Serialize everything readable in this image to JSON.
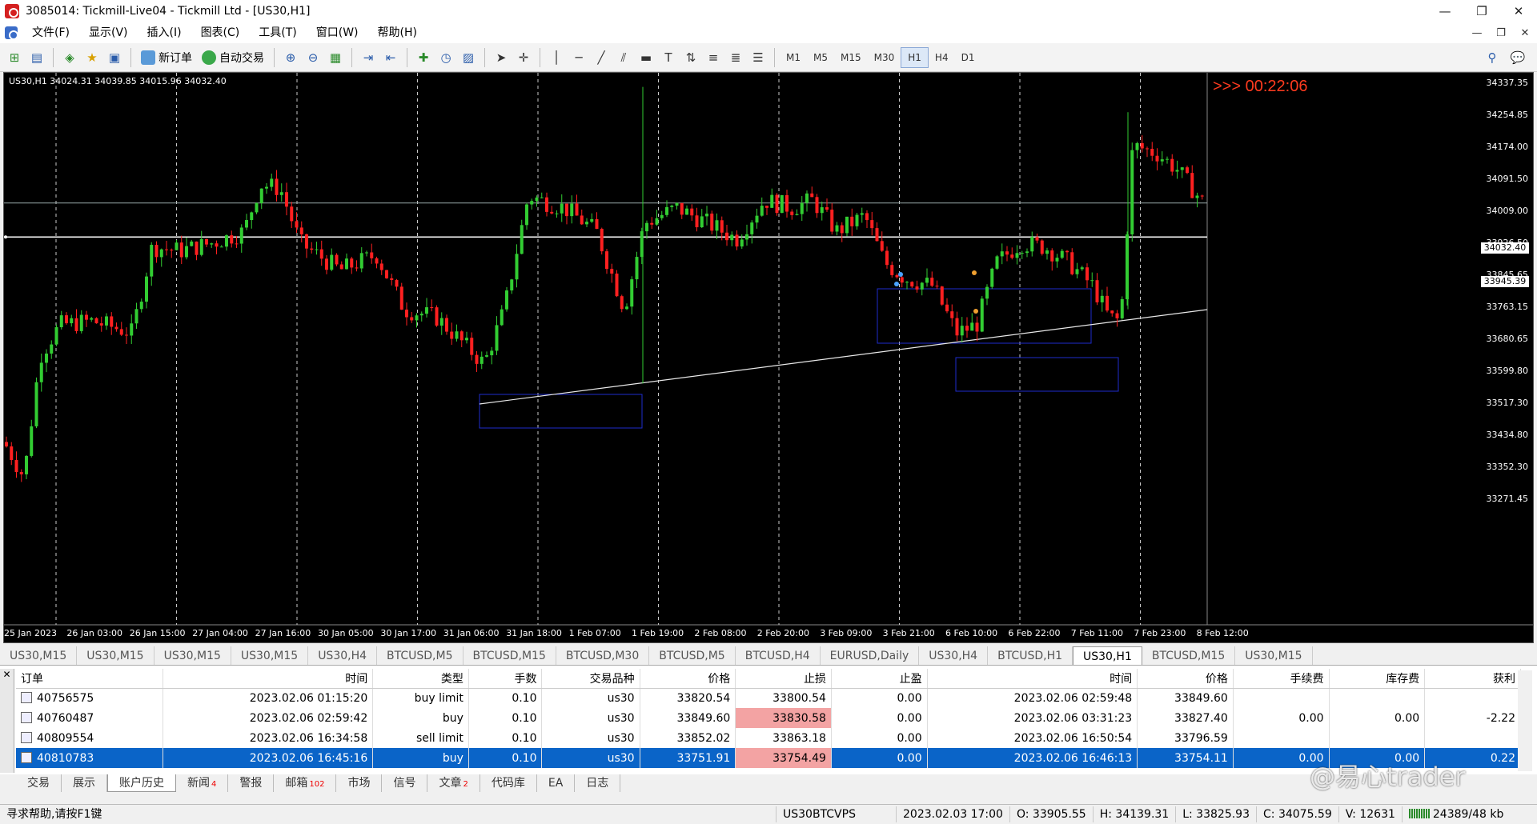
{
  "window": {
    "title": "3085014: Tickmill-Live04 - Tickmill Ltd - [US30,H1]"
  },
  "menu": [
    "文件(F)",
    "显示(V)",
    "插入(I)",
    "图表(C)",
    "工具(T)",
    "窗口(W)",
    "帮助(H)"
  ],
  "toolbar": {
    "new_order": "新订单",
    "auto_trading": "自动交易",
    "timeframes": [
      "M1",
      "M5",
      "M15",
      "M30",
      "H1",
      "H4",
      "D1"
    ],
    "active_timeframe": "H1"
  },
  "chart": {
    "info": "US30,H1  34024.31 34039.85 34015.96 34032.40",
    "countdown": ">>> 00:22:06",
    "price_axis": [
      "34337.35",
      "34254.85",
      "34174.00",
      "34091.50",
      "34009.00",
      "33926.50",
      "33845.65",
      "33763.15",
      "33680.65",
      "33599.80",
      "33517.30",
      "33434.80",
      "33352.30",
      "33271.45"
    ],
    "current_price_tag": "34032.40",
    "line_price_tag": "33945.39",
    "time_axis": [
      "25 Jan 2023",
      "26 Jan 03:00",
      "26 Jan 15:00",
      "27 Jan 04:00",
      "27 Jan 16:00",
      "30 Jan 05:00",
      "30 Jan 17:00",
      "31 Jan 06:00",
      "31 Jan 18:00",
      "1 Feb 07:00",
      "1 Feb 19:00",
      "2 Feb 08:00",
      "2 Feb 20:00",
      "3 Feb 09:00",
      "3 Feb 21:00",
      "6 Feb 10:00",
      "6 Feb 22:00",
      "7 Feb 11:00",
      "7 Feb 23:00",
      "8 Feb 12:00"
    ],
    "colors": {
      "bull": "#32cd32",
      "bear": "#ff2020",
      "background": "#000000"
    }
  },
  "chart_tabs": [
    "US30,M15",
    "US30,M15",
    "US30,M15",
    "US30,M15",
    "US30,H4",
    "BTCUSD,M5",
    "BTCUSD,M15",
    "BTCUSD,M30",
    "BTCUSD,M5",
    "BTCUSD,H4",
    "EURUSD,Daily",
    "US30,H4",
    "BTCUSD,H1",
    "US30,H1",
    "BTCUSD,M15",
    "US30,M15"
  ],
  "active_chart_tab": 13,
  "terminal": {
    "headers": [
      "订单",
      "时间",
      "类型",
      "手数",
      "交易品种",
      "价格",
      "止损",
      "止盈",
      "时间",
      "价格",
      "手续费",
      "库存费",
      "获利"
    ],
    "rows": [
      {
        "order": "40756575",
        "time": "2023.02.06 01:15:20",
        "type": "buy limit",
        "lots": "0.10",
        "symbol": "us30",
        "price": "33820.54",
        "sl": "33800.54",
        "tp": "0.00",
        "close_time": "2023.02.06 02:59:48",
        "close_price": "33849.60",
        "commission": "",
        "swap": "",
        "profit": ""
      },
      {
        "order": "40760487",
        "time": "2023.02.06 02:59:42",
        "type": "buy",
        "lots": "0.10",
        "symbol": "us30",
        "price": "33849.60",
        "sl": "33830.58",
        "tp": "0.00",
        "close_time": "2023.02.06 03:31:23",
        "close_price": "33827.40",
        "commission": "0.00",
        "swap": "0.00",
        "profit": "-2.22"
      },
      {
        "order": "40809554",
        "time": "2023.02.06 16:34:58",
        "type": "sell limit",
        "lots": "0.10",
        "symbol": "us30",
        "price": "33852.02",
        "sl": "33863.18",
        "tp": "0.00",
        "close_time": "2023.02.06 16:50:54",
        "close_price": "33796.59",
        "commission": "",
        "swap": "",
        "profit": ""
      },
      {
        "order": "40810783",
        "time": "2023.02.06 16:45:16",
        "type": "buy",
        "lots": "0.10",
        "symbol": "us30",
        "price": "33751.91",
        "sl": "33754.49",
        "tp": "0.00",
        "close_time": "2023.02.06 16:46:13",
        "close_price": "33754.11",
        "commission": "0.00",
        "swap": "0.00",
        "profit": "0.22"
      }
    ],
    "tabs": [
      "交易",
      "展示",
      "账户历史",
      "新闻",
      "警报",
      "邮箱",
      "市场",
      "信号",
      "文章",
      "代码库",
      "EA",
      "日志"
    ],
    "tab_badges": {
      "新闻": "4",
      "邮箱": "102",
      "文章": "2"
    },
    "active_tab": "账户历史"
  },
  "status": {
    "help": "寻求帮助,请按F1键",
    "profile": "US30BTCVPS",
    "datetime": "2023.02.03 17:00",
    "open": "O: 33905.55",
    "high": "H: 34139.31",
    "low": "L: 33825.93",
    "close": "C: 34075.59",
    "volume": "V: 12631",
    "traffic": "24389/48 kb"
  },
  "watermark": "@易心trader"
}
